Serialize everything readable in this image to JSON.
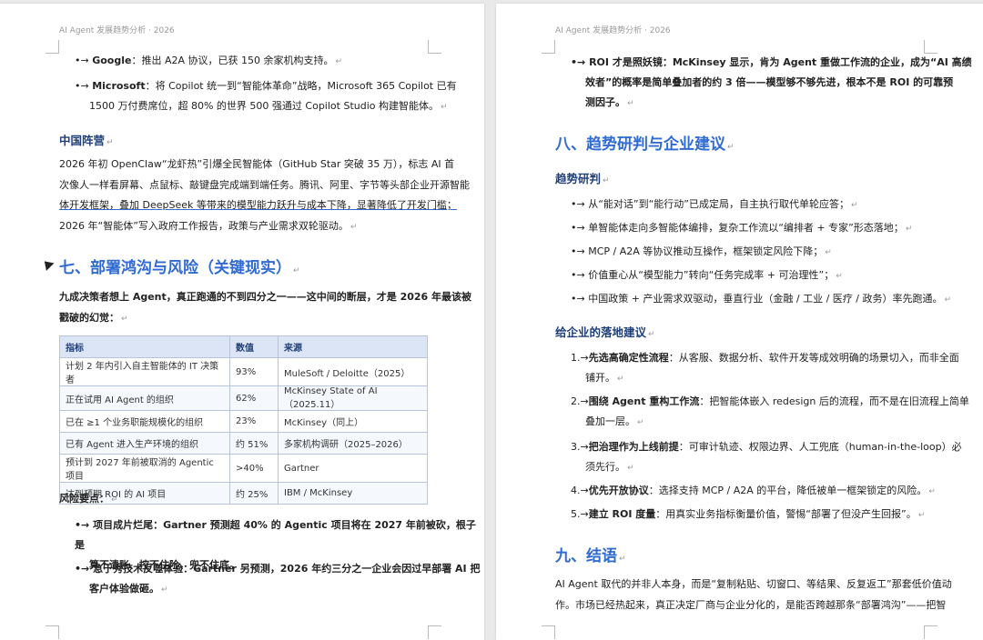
{
  "header": "AI Agent 发展趋势分析 · 2026",
  "left": {
    "bullet_google": {
      "label": "Google",
      "text": "：推出 A2A 协议，已获 150 余家机构支持。"
    },
    "bullet_ms": {
      "label": "Microsoft",
      "line1": "：将 Copilot 统一到“智能体革命”战略，Microsoft 365 Copilot 已有",
      "line2": "1500 万付费席位，超 80% 的世界 500 强通过 Copilot Studio 构建智能体。"
    },
    "china_heading": "中国阵营",
    "china_lines": [
      "2026 年初 OpenClaw“龙虾热”引爆全民智能体（GitHub Star 突破 35 万），标志 AI 首",
      "次像人一样看屏幕、点鼠标、敲键盘完成端到端任务。腾讯、阿里、字节等头部企业开源智能",
      "体开发框架，叠加 DeepSeek 等带来的模型能力跃升与成本下降，显著降低了开发门槛；",
      "2026 年“智能体”写入政府工作报告，政策与产业需求双轮驱动。"
    ],
    "section7_title": "七、部署鸿沟与风险（关键现实）",
    "intro_lines": [
      "九成决策者想上 Agent，真正跑通的不到四分之一——这中间的断层，才是 2026 年最该被",
      "戳破的幻觉："
    ],
    "table": {
      "headers": [
        "指标",
        "数值",
        "来源"
      ],
      "rows": [
        [
          "计划 2 年内引入自主智能体的 IT 决策者",
          "93%",
          "MuleSoft / Deloitte（2025）"
        ],
        [
          "正在试用 AI Agent 的组织",
          "62%",
          "McKinsey State of AI（2025.11）"
        ],
        [
          "已在 ≥1 个业务职能规模化的组织",
          "23%",
          "McKinsey（同上）"
        ],
        [
          "已有 Agent 进入生产环境的组织",
          "约 51%",
          "多家机构调研（2025–2026）"
        ],
        [
          "预计到 2027 年前被取消的 Agentic 项目",
          ">40%",
          "Gartner"
        ],
        [
          "达到预期 ROI 的 AI 项目",
          "约 25%",
          "IBM / McKinsey"
        ]
      ]
    },
    "risk_heading": "风险要点：",
    "risk_bullets": [
      {
        "line1": "项目成片烂尾：Gartner 预测超 40% 的 Agentic 项目将在 2027 年前被砍，根子是",
        "line2": "算不清账、控不住险、兜不住底。"
      },
      {
        "line1": "急于秀技术反噬体验：Gartner 另预测，2026 年约三分之一企业会因过早部署 AI 把",
        "line2": "客户体验做砸。"
      }
    ]
  },
  "right": {
    "roi_bullet": {
      "line1": "ROI 才是照妖镜：McKinsey 显示，肯为 Agent 重做工作流的企业，成为“AI 高绩",
      "line2": "效者”的概率是简单叠加者的约 3 倍——模型够不够先进，根本不是 ROI 的可靠预",
      "line3": "测因子。"
    },
    "section8_title": "八、趋势研判与企业建议",
    "trend_heading": "趋势研判",
    "trend_bullets": [
      "从“能对话”到“能行动”已成定局，自主执行取代单轮应答；",
      "单智能体走向多智能体编排，复杂工作流以“编排者 + 专家”形态落地；",
      "MCP / A2A 等协议推动互操作，框架锁定风险下降；",
      "价值重心从“模型能力”转向“任务完成率 + 可治理性”；",
      "中国政策 + 产业需求双驱动，垂直行业（金融 / 工业 / 医疗 / 政务）率先跑通。"
    ],
    "advice_heading": "给企业的落地建议",
    "advice": [
      {
        "num": "1.",
        "bold": "先选高确定性流程",
        "line1": "：从客服、数据分析、软件开发等成效明确的场景切入，而非全面",
        "line2": "铺开。"
      },
      {
        "num": "2.",
        "bold": "围绕 Agent 重构工作流",
        "line1": "：把智能体嵌入 redesign 后的流程，而不是在旧流程上简单",
        "line2": "叠加一层。"
      },
      {
        "num": "3.",
        "bold": "把治理作为上线前提",
        "line1": "：可审计轨迹、权限边界、人工兜底（human-in-the-loop）必",
        "line2": "须先行。"
      },
      {
        "num": "4.",
        "bold": "优先开放协议",
        "line1": "：选择支持 MCP / A2A 的平台，降低被单一框架锁定的风险。",
        "line2": ""
      },
      {
        "num": "5.",
        "bold": "建立 ROI 度量",
        "line1": "：用真实业务指标衡量价值，警惕“部署了但没产生回报”。",
        "line2": ""
      }
    ],
    "section9_title": "九、结语",
    "conclusion_lines": [
      "AI Agent 取代的并非人本身，而是“复制粘贴、切窗口、等结果、反复返工”那套低价值动",
      "作。市场已经热起来，真正决定厂商与企业分化的，是能否跨越那条“部署鸿沟”——把智"
    ]
  },
  "colors": {
    "heading_blue": "#2f6bd3",
    "subheading_navy": "#1f3f78",
    "table_header": "#dbe5f5"
  }
}
